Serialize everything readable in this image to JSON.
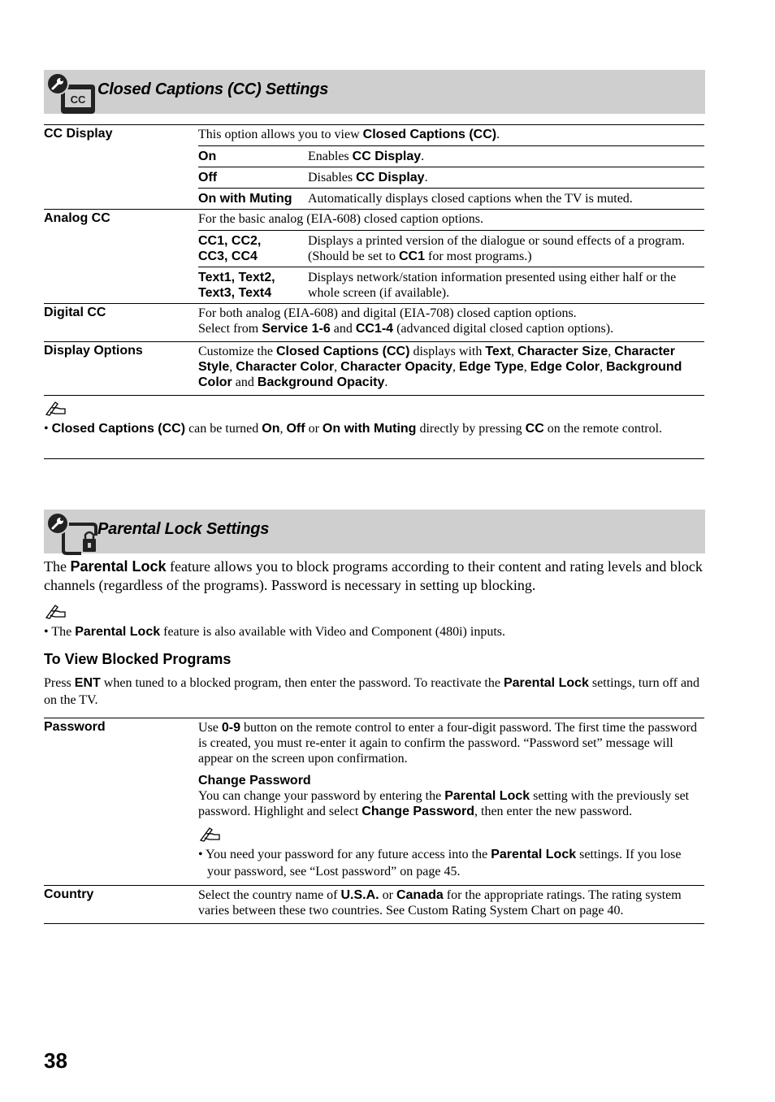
{
  "cc_section": {
    "title": "Closed Captions (CC) Settings",
    "icon": "wrench-cc-icon",
    "icon_text": "CC",
    "rows": [
      {
        "label": "CC Display",
        "desc": [
          "This option allows you to view ",
          {
            "b": "Closed Captions (CC)"
          },
          "."
        ],
        "subs": [
          {
            "label": "On",
            "desc": [
              "Enables ",
              {
                "b": "CC Display"
              },
              "."
            ]
          },
          {
            "label": "Off",
            "desc": [
              "Disables ",
              {
                "b": "CC Display"
              },
              "."
            ]
          },
          {
            "label": "On with Muting",
            "desc": [
              "Automatically displays closed captions when the TV is muted."
            ]
          }
        ]
      },
      {
        "label": "Analog CC",
        "desc": [
          "For the basic analog (EIA-608) closed caption options."
        ],
        "subs": [
          {
            "label_parts": [
              {
                "b": "CC1"
              },
              ", ",
              {
                "b": "CC2"
              },
              ",",
              {
                "br": true
              },
              {
                "b": "CC3"
              },
              ", ",
              {
                "b": "CC4"
              }
            ],
            "desc": [
              "Displays a printed version of the dialogue or sound effects of a program. (Should be set to ",
              {
                "b": "CC1"
              },
              " for most programs.)"
            ]
          },
          {
            "label_parts": [
              {
                "b": "Text1"
              },
              ", ",
              {
                "b": "Text2"
              },
              ",",
              {
                "br": true
              },
              {
                "b": "Text3"
              },
              ", ",
              {
                "b": "Text4"
              }
            ],
            "desc": [
              "Displays network/station information presented using either half or the whole screen (if available)."
            ]
          }
        ]
      },
      {
        "label": "Digital CC",
        "desc": [
          "For both analog (EIA-608) and digital (EIA-708) closed caption options.",
          {
            "br": true
          },
          "Select from ",
          {
            "b": "Service 1-6"
          },
          " and ",
          {
            "b": "CC1-4"
          },
          " (advanced digital closed caption options)."
        ],
        "subs": []
      },
      {
        "label": "Display Options",
        "desc": [
          "Customize the ",
          {
            "b": "Closed Captions (CC)"
          },
          " displays with ",
          {
            "b": "Text"
          },
          ", ",
          {
            "b": "Character Size"
          },
          ", ",
          {
            "b": "Character Style"
          },
          ", ",
          {
            "b": "Character Color"
          },
          ", ",
          {
            "b": "Character Opacity"
          },
          ", ",
          {
            "b": "Edge Type"
          },
          ", ",
          {
            "b": "Edge Color"
          },
          ", ",
          {
            "b": "Background Color"
          },
          " and ",
          {
            "b": "Background Opacity"
          },
          "."
        ],
        "subs": []
      }
    ],
    "note": [
      "• ",
      {
        "b": "Closed Captions (CC)"
      },
      " can be turned ",
      {
        "b": "On"
      },
      ", ",
      {
        "b": "Off"
      },
      " or ",
      {
        "b": "On with Muting"
      },
      " directly by pressing ",
      {
        "b": "CC"
      },
      " on the remote control."
    ]
  },
  "pl_section": {
    "title": "Parental Lock Settings",
    "icon": "wrench-lock-icon",
    "intro": [
      "The ",
      {
        "b": "Parental Lock"
      },
      " feature allows you to block programs according to their content and rating levels and block channels (regardless of the programs). Password is necessary in setting up blocking."
    ],
    "note": [
      "• The ",
      {
        "b": "Parental Lock"
      },
      " feature is also available with Video and Component (480i) inputs."
    ],
    "subheading": "To View Blocked Programs",
    "view_text": [
      "Press ",
      {
        "b": "ENT"
      },
      " when tuned to a blocked program, then enter the password. To reactivate the ",
      {
        "b": "Parental Lock"
      },
      " settings, turn off and on the TV."
    ],
    "rows": [
      {
        "label": "Password",
        "desc": [
          "Use ",
          {
            "b": "0-9"
          },
          " button on the remote control to enter a four-digit password. The first time the password is created, you must re-enter it again to confirm the password. “Password set” message will appear on the screen upon confirmation."
        ],
        "change_title": "Change Password",
        "change_desc": [
          "You can change your password by entering the ",
          {
            "b": "Parental Lock"
          },
          " setting with the previously set password. Highlight and select ",
          {
            "b": "Change Password"
          },
          ", then enter the new password."
        ],
        "note": [
          "• You need your password for any future access into the ",
          {
            "b": "Parental Lock"
          },
          " settings. If you lose your password, see “Lost password” on page 45."
        ]
      },
      {
        "label": "Country",
        "desc": [
          "Select the country name of ",
          {
            "b": "U.S.A."
          },
          " or ",
          {
            "b": "Canada"
          },
          " for the appropriate ratings. The rating system varies between these two countries. See Custom Rating System Chart on page 40."
        ]
      }
    ]
  },
  "page_number": "38"
}
